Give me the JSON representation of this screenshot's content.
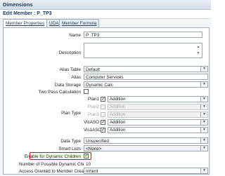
{
  "window": {
    "title": "Dimensions"
  },
  "dialog": {
    "title": "Edit Member : P_TP3"
  },
  "tabs": [
    {
      "label": "Member Properties"
    },
    {
      "label": "UDA"
    },
    {
      "label": "Member Formula"
    }
  ],
  "fields": {
    "name": {
      "label": "Name",
      "value": "P_TP3"
    },
    "description": {
      "label": "Description",
      "value": ""
    },
    "alias_table": {
      "label": "Alias Table",
      "value": "Default"
    },
    "alias": {
      "label": "Alias",
      "value": "Computer Services"
    },
    "data_storage": {
      "label": "Data Storage",
      "value": "Dynamic Calc"
    },
    "two_pass": {
      "label": "Two Pass Calculation",
      "checked": false
    },
    "plan_type": {
      "label": "Plan Type",
      "rows": [
        {
          "name": "Plan1",
          "checked": true,
          "agg": "Addition",
          "enabled": true
        },
        {
          "name": "Plan2",
          "checked": false,
          "agg": "Addition",
          "enabled": false
        },
        {
          "name": "Plan3",
          "checked": false,
          "agg": "Addition",
          "enabled": false
        },
        {
          "name": "VisASO",
          "checked": true,
          "agg": "Addition",
          "enabled": true
        },
        {
          "name": "Vis1ASO",
          "checked": true,
          "agg": "Addition",
          "enabled": true
        }
      ]
    },
    "data_type": {
      "label": "Data Type",
      "value": "Unspecified"
    },
    "smart_lists": {
      "label": "Smart Lists",
      "value": "<None>"
    },
    "enable_dynamic_children": {
      "label": "Enable for Dynamic Children",
      "checked": true
    },
    "possible_dynamic_children": {
      "label": "Number of Possible Dynamic Children",
      "value": "10"
    },
    "access_granted": {
      "label": "Access Granted to Member Creator",
      "value": "Inherit"
    }
  },
  "colors": {
    "highlight": "#d40f0f",
    "header_text": "#1e3f66"
  }
}
